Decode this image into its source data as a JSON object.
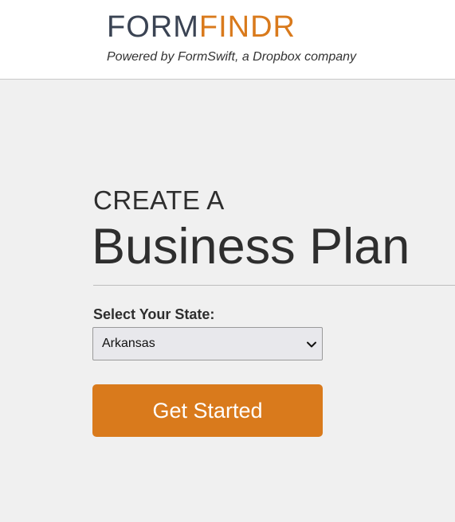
{
  "header": {
    "logo_part1": "FORM",
    "logo_part2": "FINDR",
    "tagline": "Powered by FormSwift, a Dropbox company"
  },
  "main": {
    "kicker": "CREATE A",
    "headline": "Business Plan",
    "state_label": "Select Your State:",
    "state_selected": "Arkansas",
    "start_button_label": "Get Started"
  },
  "colors": {
    "brand_dark": "#3a4353",
    "brand_orange": "#d97a1c",
    "page_background": "#f0f0f0"
  },
  "icons": {
    "select_arrow": "chevron-down-icon"
  }
}
